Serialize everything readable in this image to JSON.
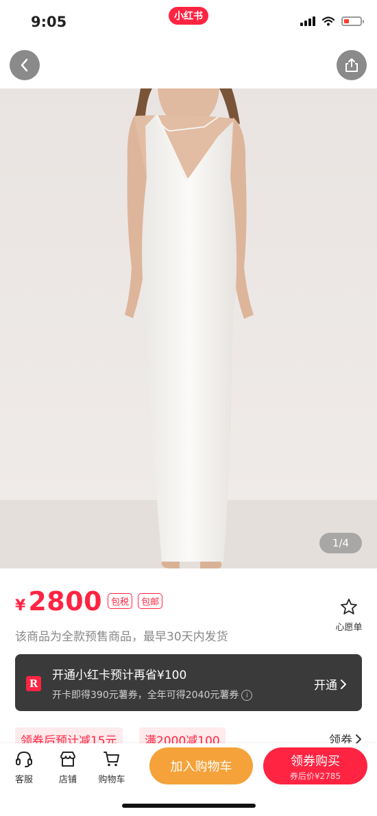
{
  "status_bar": {
    "time": "9:05",
    "app_badge": "小红书"
  },
  "gallery": {
    "counter": "1/4"
  },
  "product": {
    "currency": "¥",
    "price": "2800",
    "tags": [
      "包税",
      "包邮"
    ],
    "wishlist_label": "心愿单",
    "presale_note": "该商品为全款预售商品，最早30天内发货"
  },
  "member_card": {
    "logo": "R",
    "title": "开通小红卡预计再省¥100",
    "subtitle": "开卡即得390元薯券，全年可得2040元薯券",
    "info_icon": "i",
    "action": "开通"
  },
  "coupons": {
    "chips": [
      "领券后预计减15元",
      "满2000减100"
    ],
    "claim_label": "领券"
  },
  "bottom_bar": {
    "service_label": "客服",
    "store_label": "店铺",
    "cart_label": "购物车",
    "add_to_cart": "加入购物车",
    "buy_label": "领券购买",
    "buy_sub": "券后价¥2785"
  },
  "colors": {
    "accent": "#ff2442",
    "cart_button": "#f5a23a",
    "card_bg": "#3a3a3a"
  }
}
